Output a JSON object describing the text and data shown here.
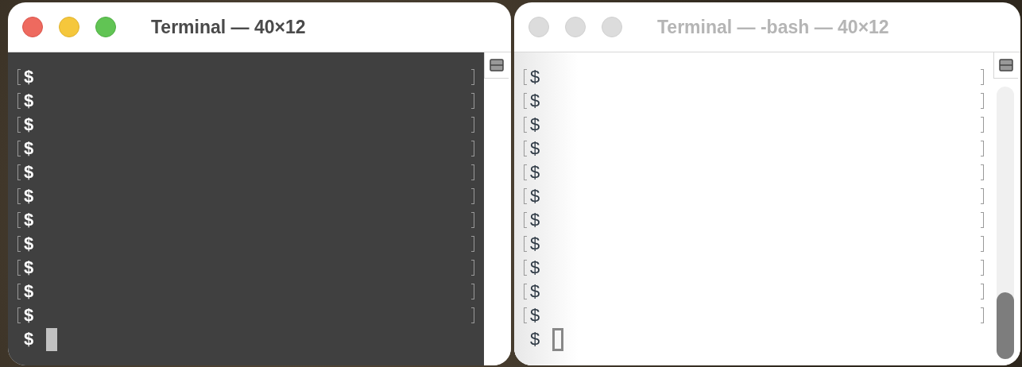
{
  "windows": [
    {
      "title": "Terminal — 40×12",
      "active": true,
      "dark": true,
      "scrollbar": false,
      "lines": [
        {
          "prompt": "$",
          "marked": true
        },
        {
          "prompt": "$",
          "marked": true
        },
        {
          "prompt": "$",
          "marked": true
        },
        {
          "prompt": "$",
          "marked": true
        },
        {
          "prompt": "$",
          "marked": true
        },
        {
          "prompt": "$",
          "marked": true
        },
        {
          "prompt": "$",
          "marked": true
        },
        {
          "prompt": "$",
          "marked": true
        },
        {
          "prompt": "$",
          "marked": true
        },
        {
          "prompt": "$",
          "marked": true
        },
        {
          "prompt": "$",
          "marked": true
        },
        {
          "prompt": "$",
          "marked": false
        }
      ]
    },
    {
      "title": "Terminal — -bash — 40×12",
      "active": false,
      "dark": false,
      "scrollbar": true,
      "lines": [
        {
          "prompt": "$",
          "marked": true
        },
        {
          "prompt": "$",
          "marked": true
        },
        {
          "prompt": "$",
          "marked": true
        },
        {
          "prompt": "$",
          "marked": true
        },
        {
          "prompt": "$",
          "marked": true
        },
        {
          "prompt": "$",
          "marked": true
        },
        {
          "prompt": "$",
          "marked": true
        },
        {
          "prompt": "$",
          "marked": true
        },
        {
          "prompt": "$",
          "marked": true
        },
        {
          "prompt": "$",
          "marked": true
        },
        {
          "prompt": "$",
          "marked": true
        },
        {
          "prompt": "$",
          "marked": false
        }
      ]
    }
  ]
}
